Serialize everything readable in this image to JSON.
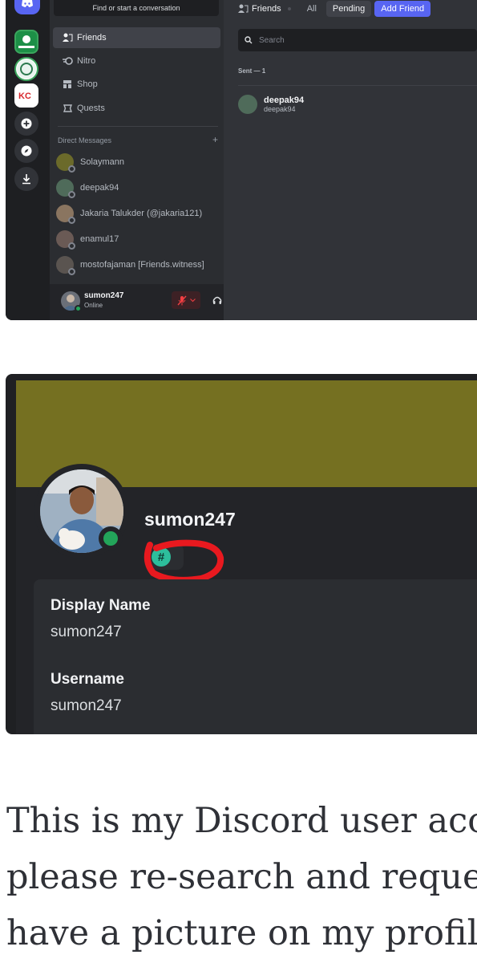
{
  "screenshot1": {
    "finder": "Find or start a conversation",
    "nav": [
      {
        "label": "Friends",
        "icon": "friends-icon",
        "selected": true
      },
      {
        "label": "Nitro",
        "icon": "nitro-icon",
        "selected": false
      },
      {
        "label": "Shop",
        "icon": "shop-icon",
        "selected": false
      },
      {
        "label": "Quests",
        "icon": "quests-icon",
        "selected": false
      }
    ],
    "dm_header": "Direct Messages",
    "dm_add": "+",
    "dms": [
      {
        "name": "Solaymann"
      },
      {
        "name": "deepak94"
      },
      {
        "name": "Jakaria Talukder (@jakaria121)"
      },
      {
        "name": "enamul17"
      },
      {
        "name": "mostofajaman [Friends.witness]"
      }
    ],
    "user": {
      "name": "sumon247",
      "status": "Online"
    },
    "topbar": {
      "friends": "Friends",
      "tab_all": "All",
      "tab_pending": "Pending",
      "tab_add": "Add Friend"
    },
    "search_placeholder": "Search",
    "sent_label": "Sent — 1",
    "pending": {
      "name": "deepak94",
      "username": "deepak94"
    },
    "colors": {
      "blurple": "#5865f2",
      "online": "#23a55a"
    }
  },
  "profile": {
    "name": "sumon247",
    "badge": "#",
    "display_name_label": "Display Name",
    "display_name": "sumon247",
    "username_label": "Username",
    "username": "sumon247",
    "banner_color": "#757021",
    "annotation_color": "#e8191f"
  },
  "caption": {
    "line1": "This is my Discord user acco",
    "line2": "please re-search and request",
    "line3": "have a picture on my profile."
  }
}
